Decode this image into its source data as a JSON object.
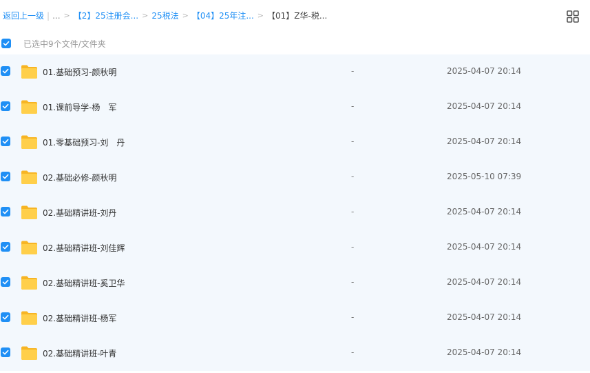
{
  "breadcrumb": {
    "back": "返回上一级",
    "ellipsis": "...",
    "items": [
      "【2】25注册会...",
      "25税法",
      "【04】25年注...",
      "【01】Z华-税..."
    ]
  },
  "selection": {
    "label": "已选中9个文件/文件夹"
  },
  "files": [
    {
      "name": "01.基础预习-颜秋明",
      "size": "-",
      "date": "2025-04-07 20:14"
    },
    {
      "name": "01.课前导学-杨　军",
      "size": "-",
      "date": "2025-04-07 20:14"
    },
    {
      "name": "01.零基础预习-刘　丹",
      "size": "-",
      "date": "2025-04-07 20:14"
    },
    {
      "name": "02.基础必修-颜秋明",
      "size": "-",
      "date": "2025-05-10 07:39"
    },
    {
      "name": "02.基础精讲班-刘丹",
      "size": "-",
      "date": "2025-04-07 20:14"
    },
    {
      "name": "02.基础精讲班-刘佳辉",
      "size": "-",
      "date": "2025-04-07 20:14"
    },
    {
      "name": "02.基础精讲班-奚卫华",
      "size": "-",
      "date": "2025-04-07 20:14"
    },
    {
      "name": "02.基础精讲班-杨军",
      "size": "-",
      "date": "2025-04-07 20:14"
    },
    {
      "name": "02.基础精讲班-叶青",
      "size": "-",
      "date": "2025-04-07 20:14"
    }
  ],
  "icons": {
    "checkbox": "checkbox-checked-icon",
    "folder": "folder-icon",
    "view_toggle": "grid-view-icon"
  },
  "colors": {
    "accent": "#1f8ff5",
    "row_background": "#f3f8fd",
    "folder": "#ffc53d"
  }
}
